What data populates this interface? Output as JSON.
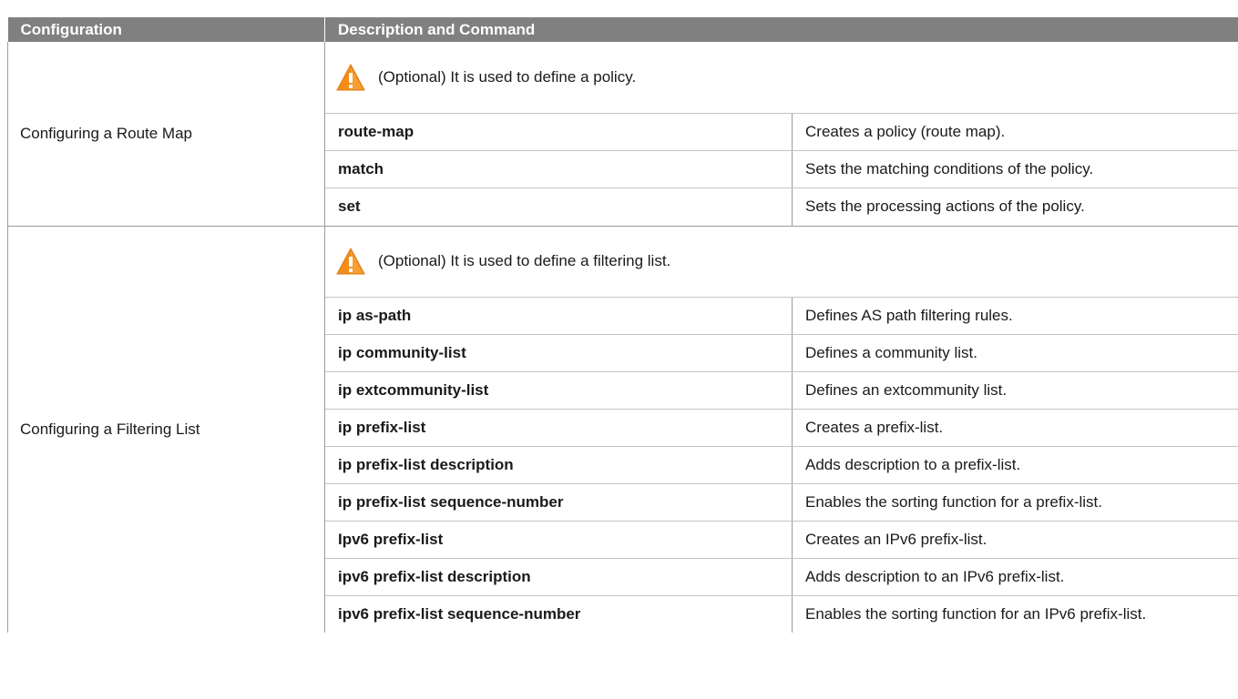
{
  "header": {
    "configuration": "Configuration",
    "description_and_command": "Description and Command"
  },
  "sections": [
    {
      "name": "Configuring a Route Map",
      "note_icon": "warning-triangle-icon",
      "note": "(Optional) It is used to define a policy.",
      "commands": [
        {
          "command": "route-map",
          "description": "Creates a policy (route map)."
        },
        {
          "command": "match",
          "description": "Sets the matching conditions of the policy."
        },
        {
          "command": "set",
          "description": "Sets the processing actions of the policy."
        }
      ]
    },
    {
      "name": "Configuring a Filtering List",
      "note_icon": "warning-triangle-icon",
      "note": "(Optional) It is used to define a filtering list.",
      "commands": [
        {
          "command": "ip as-path",
          "description": "Defines AS path filtering rules."
        },
        {
          "command": "ip community-list",
          "description": "Defines a community list."
        },
        {
          "command": "ip extcommunity-list",
          "description": "Defines an extcommunity list."
        },
        {
          "command": "ip prefix-list",
          "description": "Creates a prefix-list."
        },
        {
          "command": "ip prefix-list description",
          "description": "Adds description to a prefix-list."
        },
        {
          "command": "ip prefix-list sequence-number",
          "description": "Enables the sorting function for a prefix-list."
        },
        {
          "command": "Ipv6 prefix-list",
          "description": "Creates an IPv6 prefix-list."
        },
        {
          "command": "ipv6 prefix-list description",
          "description": "Adds description to an IPv6 prefix-list."
        },
        {
          "command": "ipv6 prefix-list sequence-number",
          "description": "Enables the sorting function for an IPv6 prefix-list."
        }
      ]
    }
  ],
  "colors": {
    "header_bg": "#808080",
    "header_text": "#ffffff",
    "warning_orange": "#f28c1a",
    "border": "#9b9b9b"
  }
}
